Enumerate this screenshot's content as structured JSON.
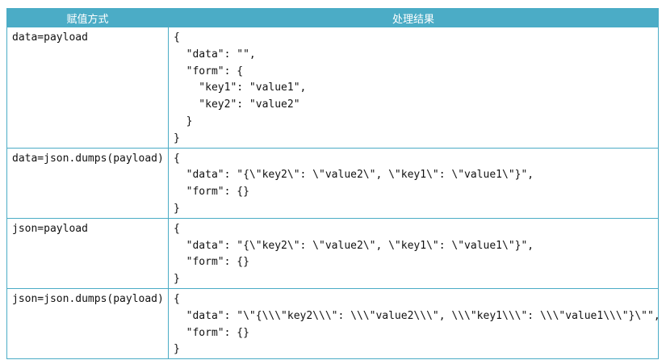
{
  "table": {
    "headers": [
      "赋值方式",
      "处理结果"
    ],
    "rows": [
      {
        "method": "data=payload",
        "result": "{\n  \"data\": \"\",\n  \"form\": {\n    \"key1\": \"value1\",\n    \"key2\": \"value2\"\n  }\n}"
      },
      {
        "method": "data=json.dumps(payload)",
        "result": "{\n  \"data\": \"{\\\"key2\\\": \\\"value2\\\", \\\"key1\\\": \\\"value1\\\"}\",\n  \"form\": {}\n}"
      },
      {
        "method": "json=payload",
        "result": "{\n  \"data\": \"{\\\"key2\\\": \\\"value2\\\", \\\"key1\\\": \\\"value1\\\"}\",\n  \"form\": {}\n}"
      },
      {
        "method": "json=json.dumps(payload)",
        "result": "{\n  \"data\": \"\\\"{\\\\\\\"key2\\\\\\\": \\\\\\\"value2\\\\\\\", \\\\\\\"key1\\\\\\\": \\\\\\\"value1\\\\\\\"}\\\"\",\n  \"form\": {}\n}"
      }
    ]
  },
  "colors": {
    "header_bg": "#4bacc6",
    "header_text": "#ffffff",
    "border": "#4bacc6",
    "divider": "#2a4d66"
  }
}
